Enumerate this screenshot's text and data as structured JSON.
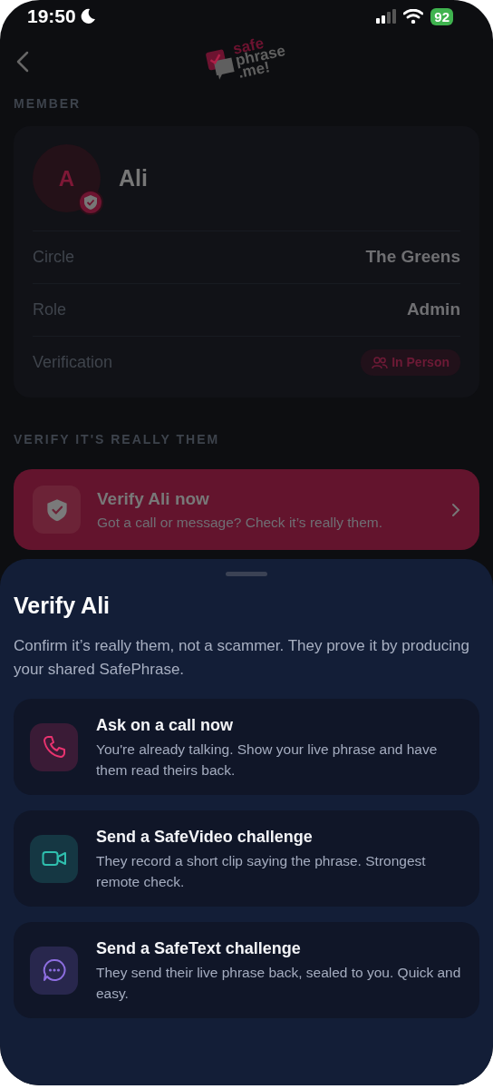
{
  "status_bar": {
    "time": "19:50",
    "battery": "92"
  },
  "header": {
    "logo": [
      "safe",
      "phrase",
      ".me!"
    ]
  },
  "member_section": {
    "title": "MEMBER",
    "avatar_initial": "A",
    "name": "Ali",
    "fields": [
      {
        "label": "Circle",
        "value": "The Greens",
        "kind": "text"
      },
      {
        "label": "Role",
        "value": "Admin",
        "kind": "text"
      },
      {
        "label": "Verification",
        "value": "In Person",
        "kind": "badge"
      }
    ]
  },
  "verify_section": {
    "title": "VERIFY IT'S REALLY THEM",
    "action": {
      "title": "Verify Ali now",
      "subtitle": "Got a call or message? Check it’s really them."
    }
  },
  "sheet": {
    "title": "Verify Ali",
    "description": "Confirm it’s really them, not a scammer. They prove it by producing your shared SafePhrase.",
    "options": [
      {
        "kind": "call",
        "color": "#e8336f",
        "title": "Ask on a call now",
        "description": "You're already talking. Show your live phrase and have them read theirs back."
      },
      {
        "kind": "video",
        "color": "#2fbfae",
        "title": "Send a SafeVideo challenge",
        "description": "They record a short clip saying the phrase. Strongest remote check."
      },
      {
        "kind": "text",
        "color": "#8d6ee0",
        "title": "Send a SafeText challenge",
        "description": "They send their live phrase back, sealed to you. Quick and easy."
      }
    ]
  }
}
